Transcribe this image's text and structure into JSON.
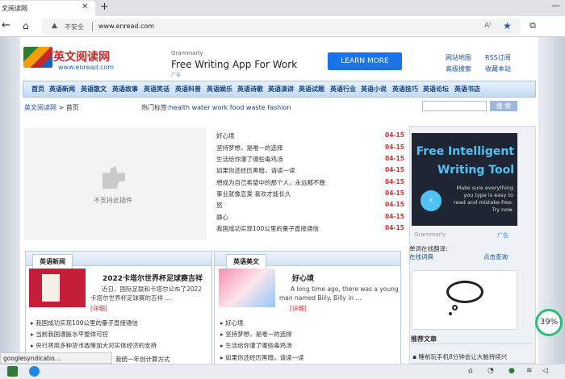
{
  "browser": {
    "tab_title": "文阅读网",
    "address_warning": "不安全",
    "url": "www.enread.com"
  },
  "site": {
    "logo_cn": "英文阅读网",
    "logo_en": "www.enread.com",
    "ad": {
      "by": "Grammarly",
      "title": "Free Writing App For Work",
      "mark": "广告",
      "button": "LEARN MORE"
    },
    "toplinks": [
      "网站地图",
      "RSS订阅",
      "高级搜索",
      "收藏本站"
    ],
    "menu": [
      "首页",
      "英语新闻",
      "英语散文",
      "英语故事",
      "英语笑话",
      "英语科普",
      "英语娱乐",
      "英语诗歌",
      "英语演讲",
      "英语试题",
      "英语行业",
      "英语小说",
      "英语技巧",
      "英语论坛",
      "英语书店"
    ],
    "breadcrumb": {
      "home": "英文阅读网",
      "sep": ">",
      "current": "首页"
    },
    "hot": {
      "label": "热门标签:",
      "words": "health water work food waste fashion"
    },
    "search_button": "搜 索",
    "plugin_text": "不支持此插件",
    "news": [
      {
        "title": "好心境",
        "date": "04-15"
      },
      {
        "title": "坚持梦想，是唯一的选择",
        "date": "04-15"
      },
      {
        "title": "生活给你灌了哪些毒鸡汤",
        "date": "04-15"
      },
      {
        "title": "如果你还经历黑暗，请读一读",
        "date": "04-15"
      },
      {
        "title": "想成为自己希望中的那个人，永远都不晚",
        "date": "04-15"
      },
      {
        "title": "事业就像恋爱 喜欢才能长久",
        "date": "04-15"
      },
      {
        "title": "怒",
        "date": "04-15"
      },
      {
        "title": "静心",
        "date": "04-15"
      },
      {
        "title": "我国成功实现100公里的量子直接通信",
        "date": "04-15"
      }
    ],
    "box_news": {
      "tab": "英语新闻",
      "article_title": "2022卡塔尔世界杯足球赛吉祥",
      "article_text": "近日，国际足联和卡塔尔公布了2022卡塔尔世界杯足球赛的吉祥 ...",
      "more": "[详细]",
      "items": [
        "我国成功实现100公里的量子直接通信",
        "当前我国通胀水平整体可控",
        "央行将用多种货币政策加大对实体经济的支持",
        "我统一年创计算方式"
      ]
    },
    "box_prose": {
      "tab": "英语美文",
      "article_title": "好心境",
      "article_text": "A long time ago, there was a young man named Billy. Billy in ...",
      "more": "[详细]",
      "items": [
        "好心境",
        "坚持梦想，是唯一的选择",
        "生活给你灌了哪些毒鸡汤",
        "如果你还经历黑暗，请读一读"
      ]
    },
    "side_ad": {
      "head": "Free Intelligent Writing Tool",
      "body": "Make sure everything you type is easy to read and mistake-free. Try now.",
      "arrow": "‹",
      "by": "Grammarly",
      "mark": "广告"
    },
    "dict": {
      "label": "单词在线翻译:",
      "link": "在线词典",
      "tip": "点击查询"
    },
    "recommend": {
      "head": "推荐文章",
      "item": "睡前玩手机8分钟会让大脑持续兴"
    }
  },
  "overlay": {
    "percent": "39%",
    "status": "googlesyndicatio..."
  }
}
